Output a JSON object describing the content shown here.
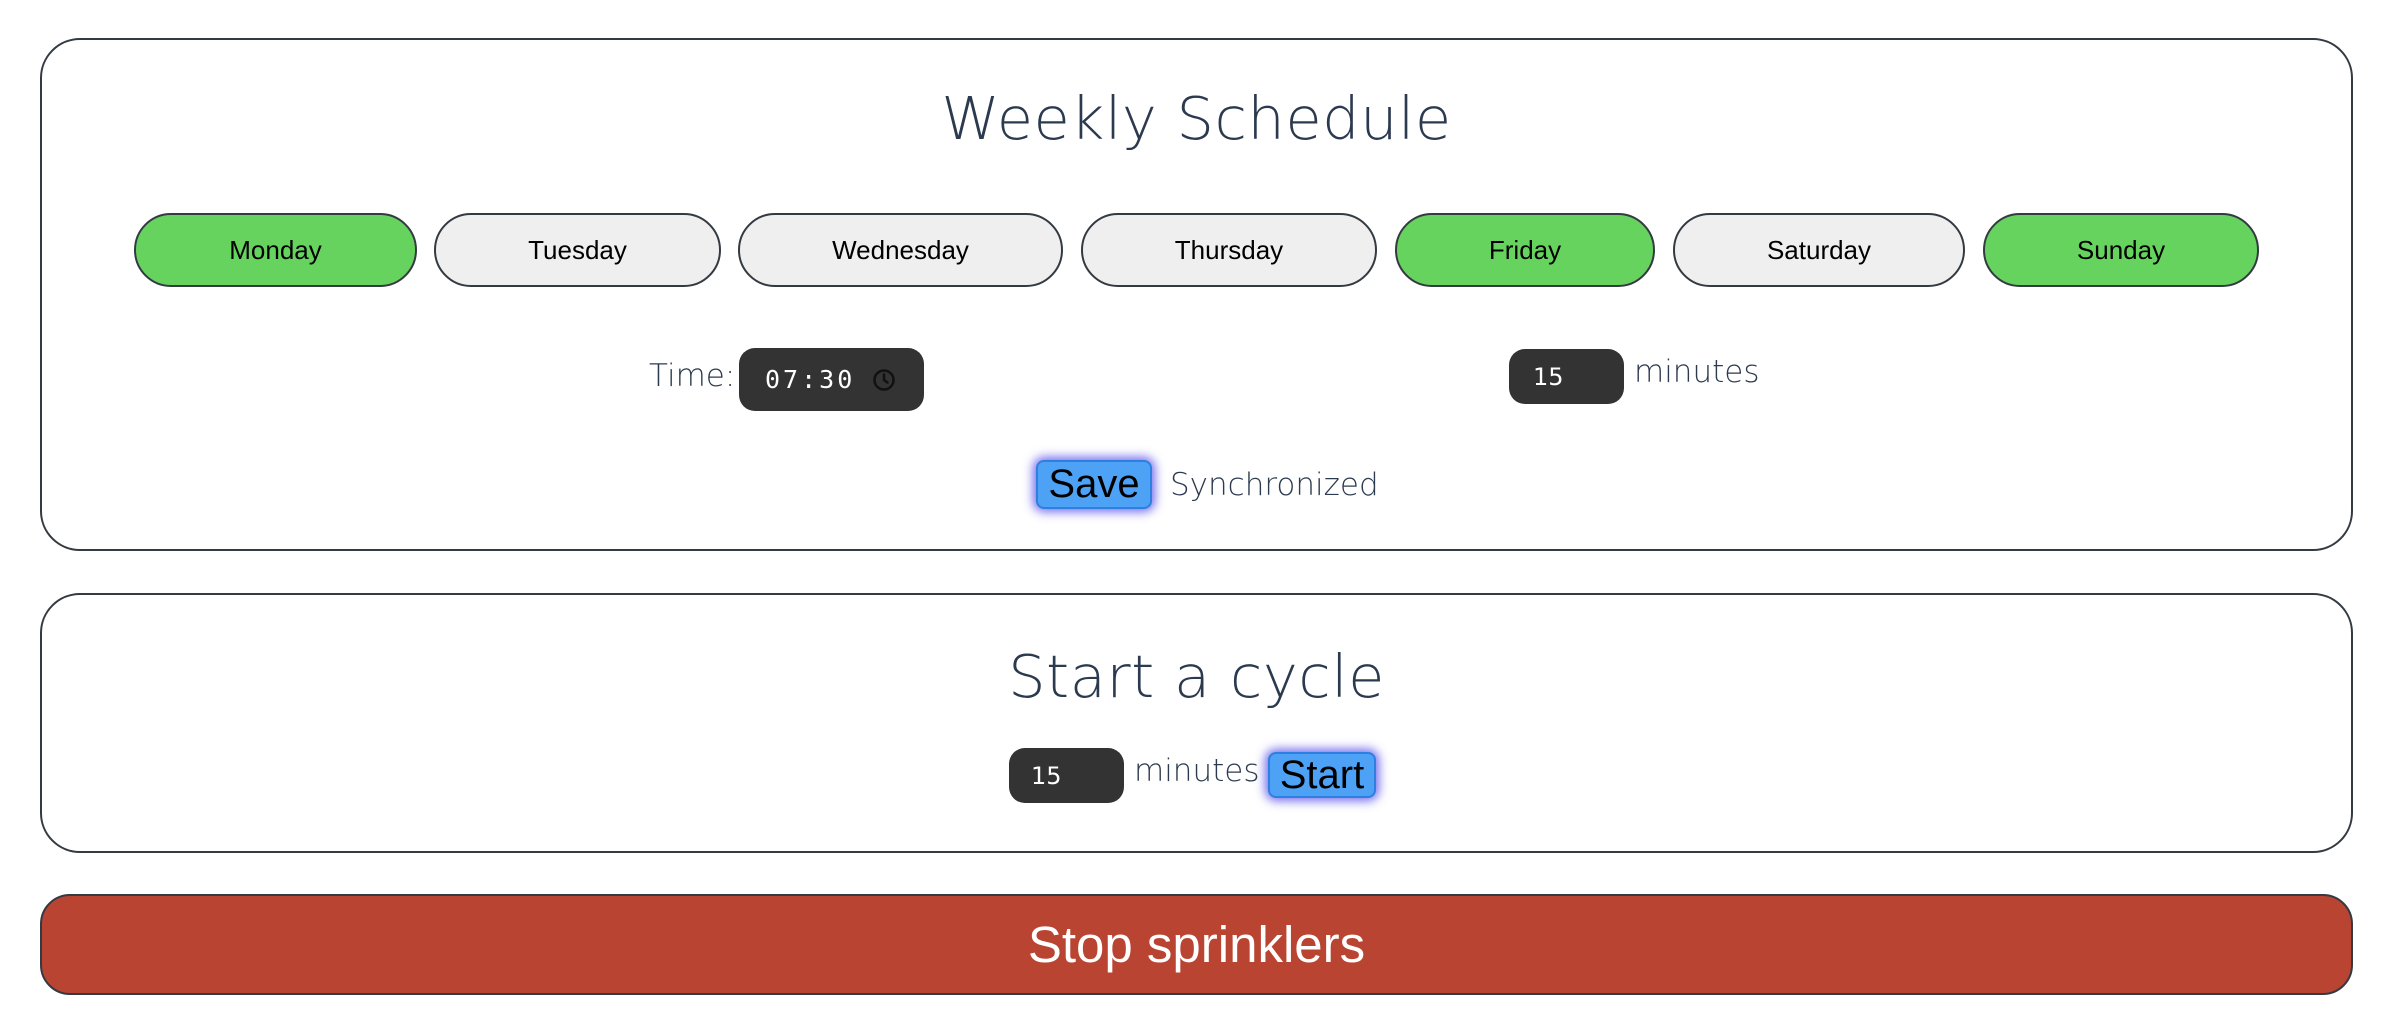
{
  "schedule": {
    "title": "Weekly Schedule",
    "days": [
      {
        "label": "Monday",
        "selected": true
      },
      {
        "label": "Tuesday",
        "selected": false
      },
      {
        "label": "Wednesday",
        "selected": false
      },
      {
        "label": "Thursday",
        "selected": false
      },
      {
        "label": "Friday",
        "selected": true
      },
      {
        "label": "Saturday",
        "selected": false
      },
      {
        "label": "Sunday",
        "selected": true
      }
    ],
    "time_label": "Time:",
    "time_value": "07:30",
    "duration_value": "15",
    "duration_unit": "minutes",
    "save_label": "Save",
    "status_text": "Synchronized"
  },
  "cycle": {
    "title": "Start a cycle",
    "duration_value": "15",
    "duration_unit": "minutes",
    "start_label": "Start"
  },
  "stop": {
    "label": "Stop sprinklers"
  },
  "colors": {
    "day_selected": "#66d35e",
    "day_unselected": "#efefef",
    "button_blue": "#4da2f5",
    "stop_red": "#b94432",
    "input_dark": "#333333",
    "heading_text": "#2c3a4f"
  },
  "icons": {
    "time_picker": "clock-icon"
  }
}
